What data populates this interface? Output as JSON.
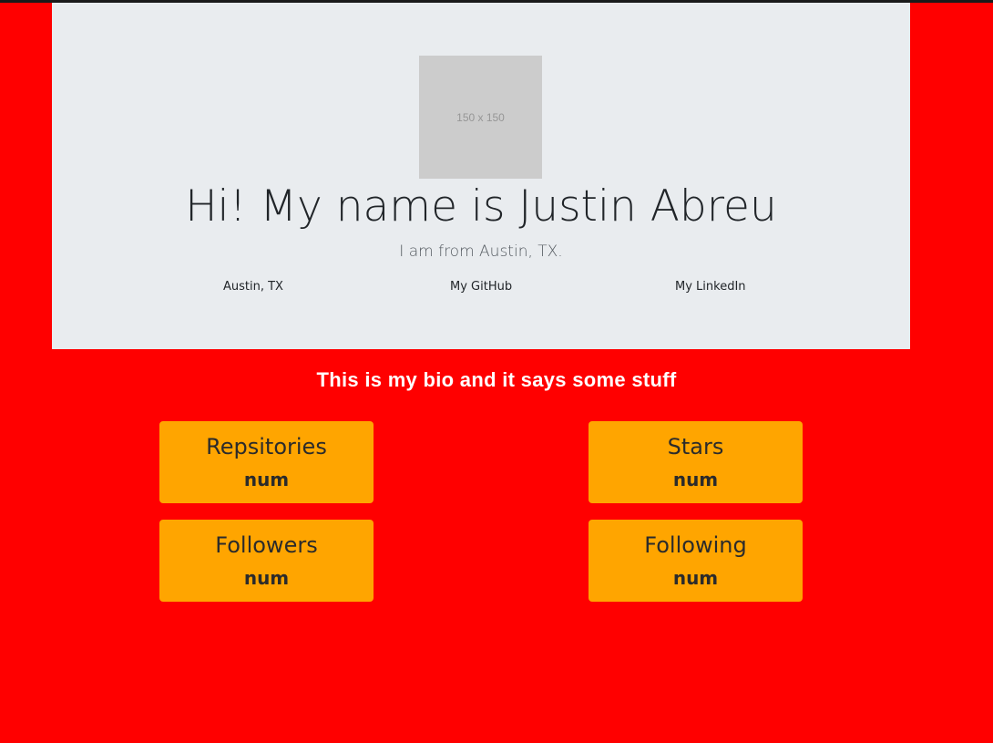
{
  "profile": {
    "avatar_placeholder": "150 x 150",
    "headline": "Hi! My name is Justin Abreu",
    "subtitle": "I am from Austin, TX.",
    "links": {
      "location": "Austin, TX",
      "github": "My GitHub",
      "linkedin": "My LinkedIn"
    }
  },
  "bio": "This is my bio and it says some stuff",
  "stats": {
    "repos": {
      "label": "Repsitories",
      "value": "num"
    },
    "stars": {
      "label": "Stars",
      "value": "num"
    },
    "followers": {
      "label": "Followers",
      "value": "num"
    },
    "following": {
      "label": "Following",
      "value": "num"
    }
  },
  "colors": {
    "page_background": "#ff0000",
    "jumbotron_background": "#e9ecef",
    "card_background": "#ffa500",
    "bio_text": "#ffffff"
  }
}
